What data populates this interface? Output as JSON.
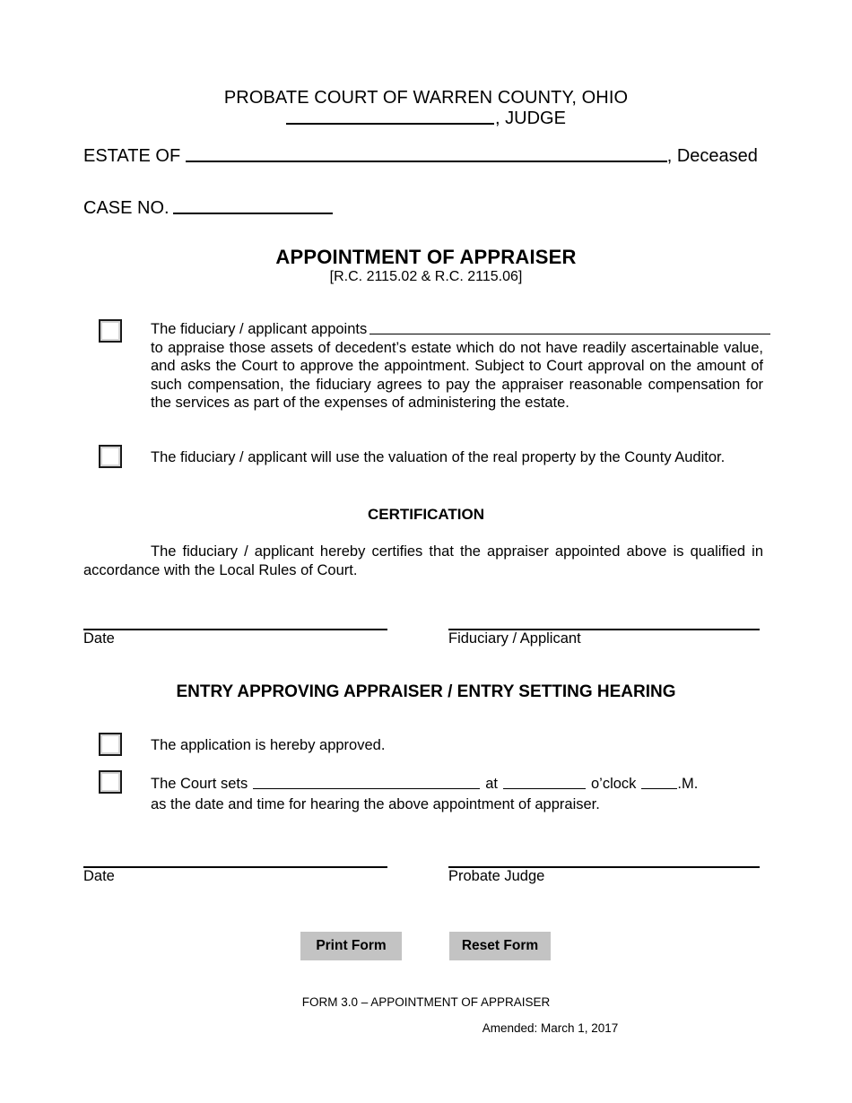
{
  "header": {
    "court_title": "PROBATE COURT OF WARREN COUNTY, OHIO",
    "judge_label": ", JUDGE",
    "estate_label": "ESTATE OF ",
    "deceased_label": ", Deceased",
    "case_no_label": "CASE NO."
  },
  "title": {
    "main": "APPOINTMENT OF APPRAISER",
    "citation": "[R.C. 2115.02 & R.C. 2115.06]"
  },
  "appoints_block": {
    "lead_text": "The fiduciary / applicant appoints",
    "body": "to appraise those assets of decedent’s estate which do not have readily ascertainable value, and asks the Court to approve the appointment.  Subject to Court approval on the amount of such compensation, the fiduciary agrees to pay the appraiser reasonable compensation for the services as part of the expenses of administering the estate."
  },
  "auditor_block": {
    "text": "The fiduciary / applicant will use the valuation of the real property by the County Auditor."
  },
  "certification": {
    "heading": "CERTIFICATION",
    "body": "The fiduciary / applicant hereby certifies that the appraiser appointed above is qualified in accordance with the Local Rules of Court."
  },
  "signature_1": {
    "date_label": "Date",
    "signer_label": "Fiduciary / Applicant"
  },
  "entry": {
    "heading": "ENTRY APPROVING APPRAISER / ENTRY SETTING HEARING",
    "approved_text": "The application is hereby approved.",
    "sets_prefix": "The  Court sets",
    "sets_at": "at",
    "sets_oclock": "o’clock",
    "sets_suffix": ".M.",
    "sets_second_line": "as the date and time for hearing the above appointment of appraiser."
  },
  "signature_2": {
    "date_label": "Date",
    "signer_label": "Probate Judge"
  },
  "buttons": {
    "print_label": "Print Form",
    "reset_label": "Reset Form",
    "face_color": "#c3c3c3"
  },
  "footer": {
    "form_id": "FORM 3.0 – APPOINTMENT OF APPRAISER",
    "amended": "Amended: March 1, 2017"
  }
}
